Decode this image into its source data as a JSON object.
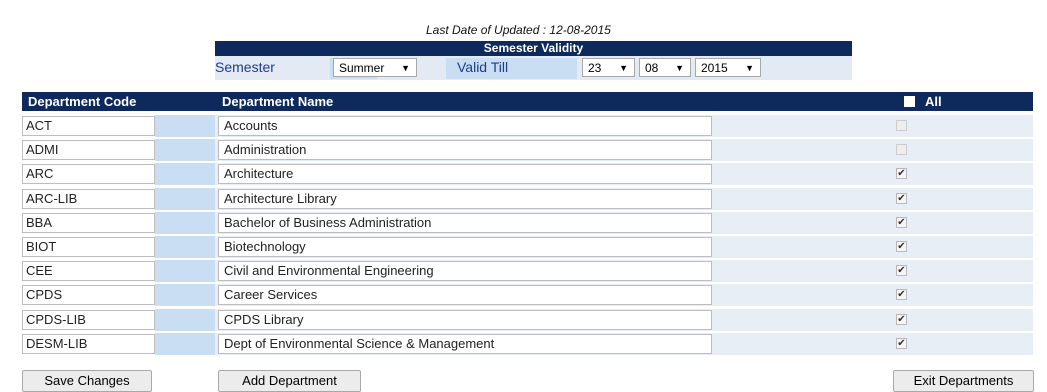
{
  "last_updated": "Last Date of Updated : 12-08-2015",
  "validity": {
    "title": "Semester Validity",
    "semester_label": "Semester",
    "semester_value": "Summer",
    "valid_till_label": "Valid Till",
    "day": "23",
    "month": "08",
    "year": "2015",
    "caret": "▼"
  },
  "table": {
    "col_code": "Department Code",
    "col_name": "Department Name",
    "col_all": "All",
    "rows": [
      {
        "code": "ACT",
        "name": "Accounts",
        "checked": false,
        "disabled": true
      },
      {
        "code": "ADMI",
        "name": "Administration",
        "checked": false,
        "disabled": true
      },
      {
        "code": "ARC",
        "name": "Architecture",
        "checked": true,
        "disabled": false
      },
      {
        "code": "ARC-LIB",
        "name": "Architecture Library",
        "checked": true,
        "disabled": false
      },
      {
        "code": "BBA",
        "name": "Bachelor of Business Administration",
        "checked": true,
        "disabled": false
      },
      {
        "code": "BIOT",
        "name": "Biotechnology",
        "checked": true,
        "disabled": false
      },
      {
        "code": "CEE",
        "name": "Civil and Environmental Engineering",
        "checked": true,
        "disabled": false
      },
      {
        "code": "CPDS",
        "name": "Career Services",
        "checked": true,
        "disabled": false
      },
      {
        "code": "CPDS-LIB",
        "name": "CPDS Library",
        "checked": true,
        "disabled": false
      },
      {
        "code": "DESM-LIB",
        "name": "Dept of Environmental Science & Management",
        "checked": true,
        "disabled": false
      }
    ]
  },
  "buttons": {
    "save": "Save Changes",
    "add": "Add Department",
    "exit": "Exit Departments"
  },
  "colors": {
    "header_bg": "#0e2a5c",
    "label_blue": "#1e3c8c",
    "cell_blue": "#c9def2",
    "row_bg": "#e8eef6"
  }
}
